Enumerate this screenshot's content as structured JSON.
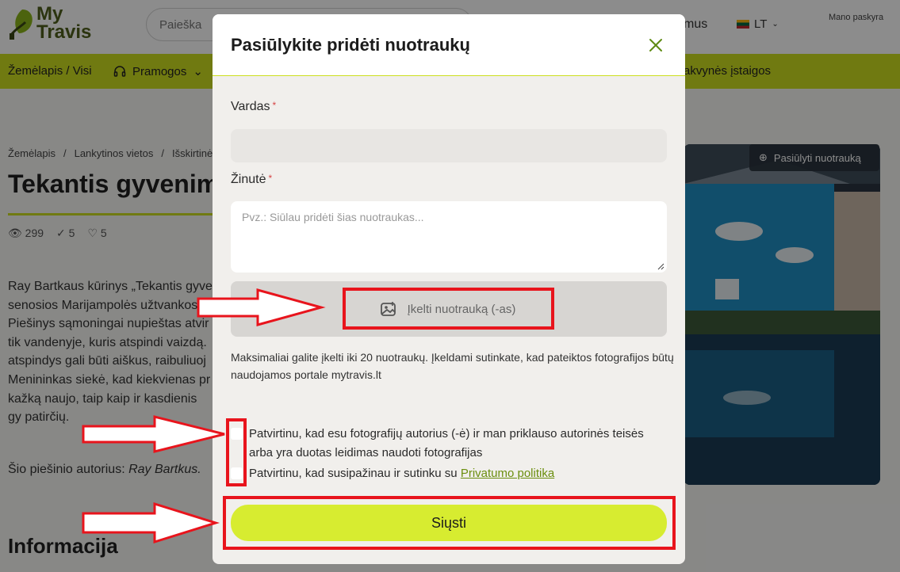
{
  "header": {
    "logo_line1": "My",
    "logo_line2": "Travis",
    "search_placeholder": "Paieška",
    "nav_partial": "mus",
    "lang": "LT",
    "account": "Mano paskyra"
  },
  "menu": {
    "item1": "Žemėlapis / Visi",
    "item2": "Pramogos",
    "item3": "akvynės įstaigos"
  },
  "page": {
    "breadcrumbs": [
      "Žemėlapis",
      "/",
      "Lankytinos vietos",
      "/",
      "Išskirtinė"
    ],
    "title": "Tekantis gyvenim",
    "views": "299",
    "checks": "5",
    "likes": "5",
    "article": "Ray Bartkaus kūrinys „Tekantis gyve senosios Marijampolės užtvankos, s Piešinys sąmoningai nupieštas atvir tik vandenyje, kuris atspindi vaizdą. atspindys gali būti aiškus, raibuliuoj Menininkas siekė, kad kiekvienas pr kažką naujo, taip kaip ir kasdienis gy patirčių.",
    "author_label": "Šio piešinio autorius:",
    "author_name": "Ray Bartkus.",
    "info_heading": "Informacija",
    "suggest_photo_label": "Pasiūlyti nuotrauką"
  },
  "modal": {
    "title": "Pasiūlykite pridėti nuotraukų",
    "name_label": "Vardas",
    "message_label": "Žinutė",
    "required_mark": "*",
    "message_placeholder": "Pvz.: Siūlau pridėti šias nuotraukas...",
    "upload_label": "Įkelti nuotrauką (-as)",
    "note": "Maksimaliai galite įkelti iki 20 nuotraukų. Įkeldami sutinkate, kad pateiktos fotografijos būtų naudojamos portale mytravis.lt",
    "consent_author": "Patvirtinu, kad esu fotografijų autorius (-ė) ir man priklauso autorinės teisės arba yra duotas leidimas naudoti fotografijas",
    "consent_privacy_prefix": "Patvirtinu, kad susipažinau ir sutinku su",
    "consent_privacy_link": "Privatumo politika",
    "submit_label": "Siųsti"
  },
  "colors": {
    "accent": "#cddf1f",
    "submit": "#d7ec30",
    "annotation": "#e8141c"
  }
}
